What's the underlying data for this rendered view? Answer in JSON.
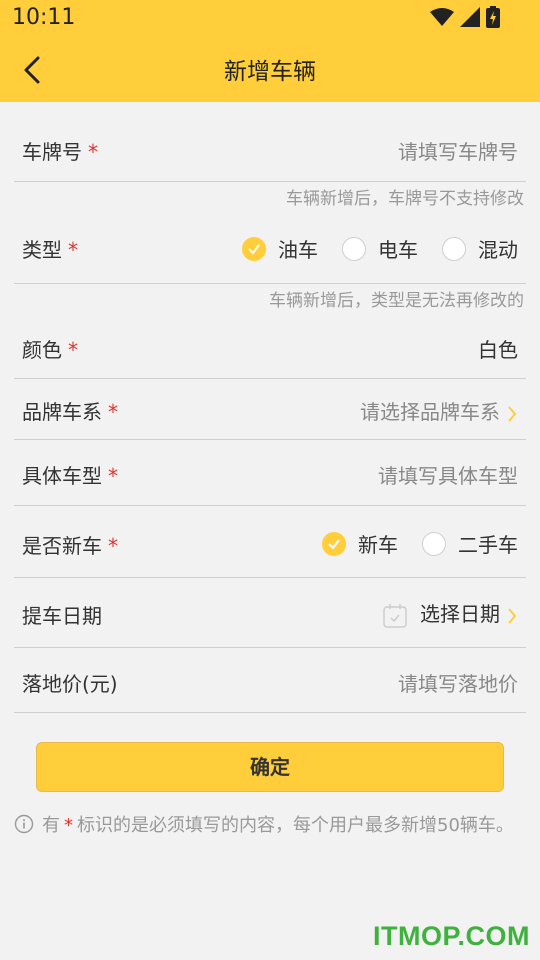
{
  "status_bar": {
    "time": "10:11"
  },
  "nav": {
    "title": "新增车辆"
  },
  "form": {
    "required_mark": "*",
    "plate": {
      "label": "车牌号",
      "placeholder": "请填写车牌号",
      "hint": "车辆新增后，车牌号不支持修改"
    },
    "type": {
      "label": "类型",
      "options": [
        "油车",
        "电车",
        "混动"
      ],
      "selected": "油车",
      "hint": "车辆新增后，类型是无法再修改的"
    },
    "color": {
      "label": "颜色",
      "value": "白色"
    },
    "brand": {
      "label": "品牌车系",
      "placeholder": "请选择品牌车系"
    },
    "model": {
      "label": "具体车型",
      "placeholder": "请填写具体车型"
    },
    "is_new": {
      "label": "是否新车",
      "options": [
        "新车",
        "二手车"
      ],
      "selected": "新车"
    },
    "pickup_date": {
      "label": "提车日期",
      "placeholder": "选择日期"
    },
    "price": {
      "label": "落地价(元)",
      "placeholder": "请填写落地价"
    }
  },
  "confirm_button": {
    "label": "确定"
  },
  "note": {
    "prefix": "有",
    "star": "*",
    "text": "标识的是必须填写的内容，每个用户最多新增50辆车。"
  },
  "watermark": "ITMOP.COM",
  "colors": {
    "accent": "#ffce3a",
    "required": "#e0312e",
    "background": "#f2f2f2"
  },
  "icons": [
    "back-arrow-icon",
    "wifi-icon",
    "signal-icon",
    "battery-icon",
    "check-icon",
    "chevron-right-icon",
    "calendar-icon",
    "info-icon"
  ]
}
